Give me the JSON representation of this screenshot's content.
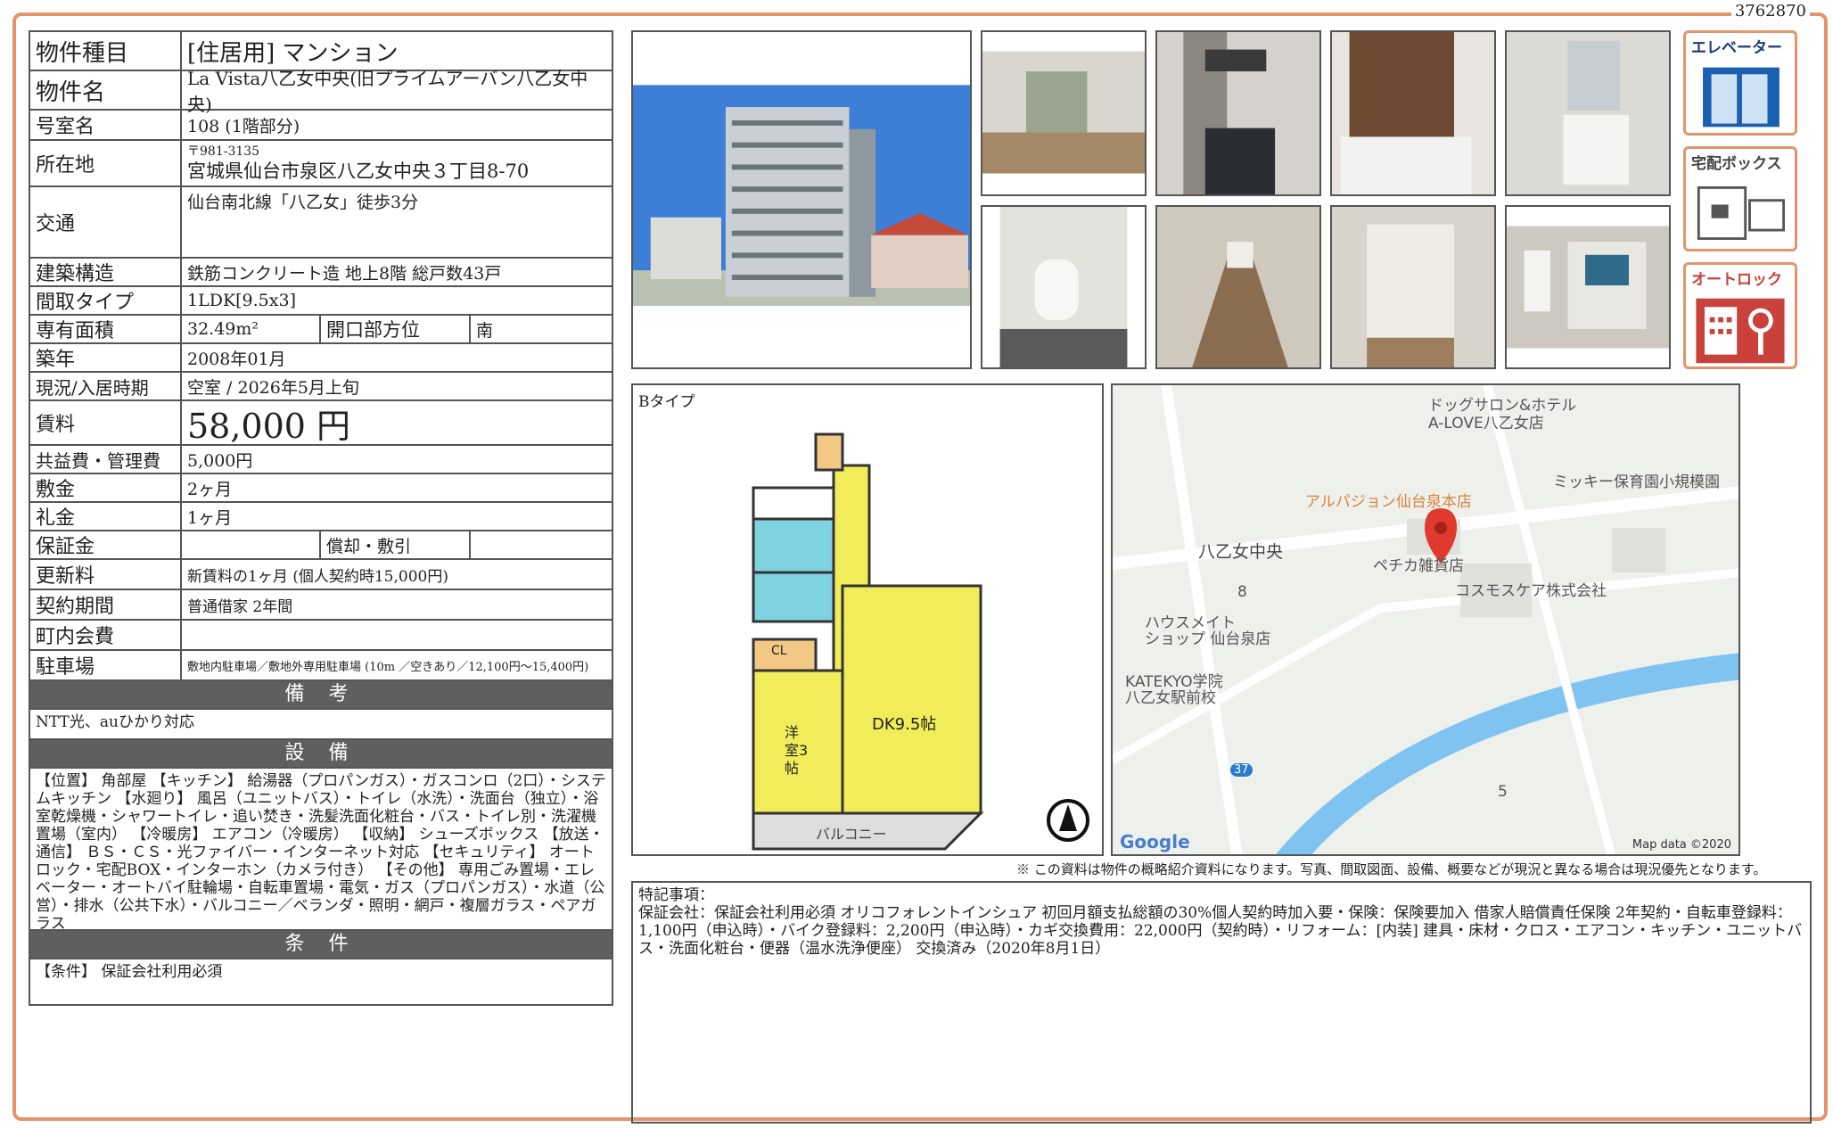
{
  "doc_id": "3762870",
  "property": {
    "type_label": "物件種目",
    "type_value": "[住居用] マンション",
    "name_label": "物件名",
    "name_value": "La Vista八乙女中央(旧プライムアーバン八乙女中央)",
    "room_label": "号室名",
    "room_value": "108 (1階部分)",
    "address_label": "所在地",
    "postal": "〒981-3135",
    "address_value": "宮城県仙台市泉区八乙女中央３丁目8-70",
    "transport_label": "交通",
    "transport_value": "仙台南北線「八乙女」徒歩3分",
    "structure_label": "建築構造",
    "structure_value": "鉄筋コンクリート造 地上8階 総戸数43戸",
    "layout_label": "間取タイプ",
    "layout_value": "1LDK[9.5x3]",
    "area_label": "専有面積",
    "area_value": "32.49m²",
    "direction_label": "開口部方位",
    "direction_value": "南",
    "built_label": "築年",
    "built_value": "2008年01月",
    "status_label": "現況/入居時期",
    "status_value": "空室 / 2026年5月上旬",
    "rent_label": "賃料",
    "rent_value": "58,000 円",
    "fee_label": "共益費・管理費",
    "fee_value": "5,000円",
    "deposit_label": "敷金",
    "deposit_value": "2ヶ月",
    "key_label": "礼金",
    "key_value": "1ヶ月",
    "guarantee_label": "保証金",
    "guarantee_value": "",
    "amort_label": "償却・敷引",
    "amort_value": "",
    "renew_label": "更新料",
    "renew_value": "新賃料の1ヶ月 (個人契約時15,000円)",
    "contract_label": "契約期間",
    "contract_value": "普通借家 2年間",
    "assoc_label": "町内会費",
    "assoc_value": "",
    "parking_label": "駐車場",
    "parking_value": "敷地内駐車場／敷地外専用駐車場 (10m ／空きあり／12,100円〜15,400円)"
  },
  "sections": {
    "remarks_title": "備 考",
    "remarks_text": "NTT光、auひかり対応",
    "equipment_title": "設 備",
    "equipment_text": "【位置】 角部屋 【キッチン】 給湯器（プロパンガス）・ガスコンロ（2口）・システムキッチン 【水廻り】 風呂（ユニットバス）・トイレ（水洗）・洗面台（独立）・浴室乾燥機・シャワートイレ・追い焚き・洗髪洗面化粧台・バス・トイレ別・洗濯機置場（室内） 【冷暖房】 エアコン（冷暖房） 【収納】 シューズボックス 【放送・通信】 ＢＳ・ＣＳ・光ファイバー・インターネット対応 【セキュリティ】 オートロック・宅配BOX・インターホン（カメラ付き） 【その他】 専用ごみ置場・エレベーター・オートバイ駐輪場・自転車置場・電気・ガス（プロパンガス）・水道（公営）・排水（公共下水）・バルコニー／ベランダ・照明・網戸・複層ガラス・ペアガラス",
    "conditions_title": "条 件",
    "conditions_text": "【条件】 保証会社利用必須"
  },
  "icons": {
    "elevator": "エレベーター",
    "delivery": "宅配ボックス",
    "autolock": "オートロック"
  },
  "floorplan": {
    "type_label": "Bタイプ",
    "dk": "DK9.5帖",
    "western": "洋室3帖",
    "balcony": "バルコニー",
    "cl": "CL"
  },
  "map": {
    "labels": [
      "ドッグサロン&ホテル",
      "A-LOVE八乙女店",
      "ミッキー保育園小規模園",
      "アルパジョン仙台泉本店",
      "八乙女中央",
      "ペチカ雑貨店",
      "コスモスケア株式会社",
      "ハウスメイト",
      "ショップ 仙台泉店",
      "KATEKYO学院",
      "八乙女駅前校",
      "8",
      "5",
      "37"
    ],
    "google": "Google",
    "credit": "Map data ©2020"
  },
  "disclaimer": "※ この資料は物件の概略紹介資料になります。写真、間取図面、設備、概要などが現況と異なる場合は現況優先となります。",
  "special_notes": "特記事項：\n保証会社：保証会社利用必須 オリコフォレントインシュア 初回月額支払総額の30%個人契約時加入要・保険：保険要加入 借家人賠償責任保険 2年契約・自転車登録料：1,100円（申込時）・バイク登録料：2,200円（申込時）・カギ交換費用：22,000円（契約時）・リフォーム：[内装] 建具・床材・クロス・エアコン・キッチン・ユニットバス・洗面化粧台・便器（温水洗浄便座） 交換済み（2020年8月1日）",
  "colors": {
    "frame": "#e2956a",
    "header_bar": "#5f5f5f",
    "icon_red": "#c9413a"
  }
}
